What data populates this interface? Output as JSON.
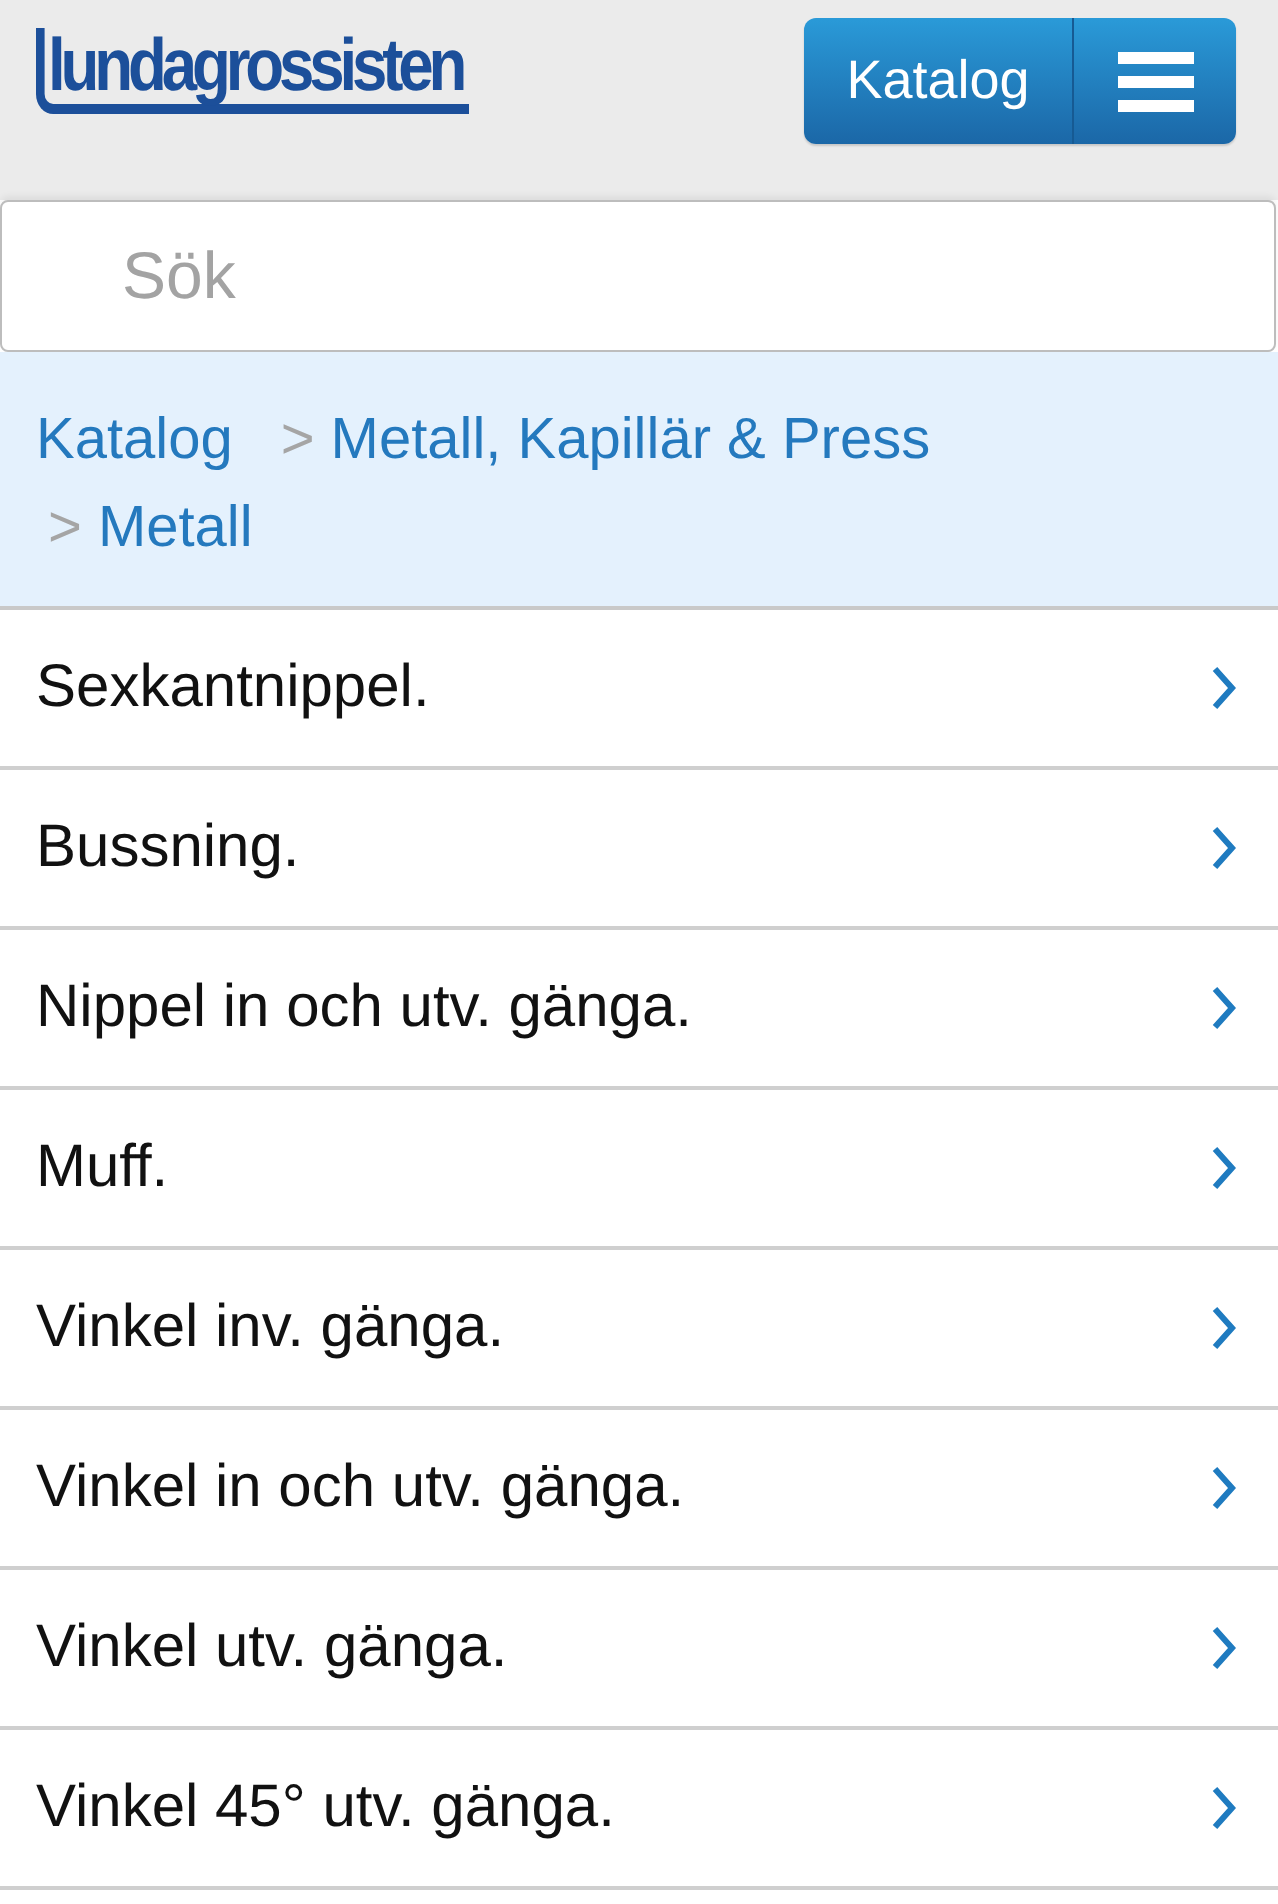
{
  "header": {
    "logo": "lundagrossisten",
    "catalog_button": "Katalog"
  },
  "search": {
    "placeholder": "Sök"
  },
  "breadcrumb": [
    {
      "label": "Katalog"
    },
    {
      "separator": ">",
      "label": "Metall, Kapillär & Press"
    },
    {
      "separator": ">",
      "label": "Metall"
    }
  ],
  "items": [
    {
      "label": "Sexkantnippel."
    },
    {
      "label": "Bussning."
    },
    {
      "label": "Nippel in och utv. gänga."
    },
    {
      "label": "Muff."
    },
    {
      "label": "Vinkel inv. gänga."
    },
    {
      "label": "Vinkel in och utv. gänga."
    },
    {
      "label": "Vinkel utv. gänga."
    },
    {
      "label": "Vinkel 45° utv. gänga."
    }
  ]
}
